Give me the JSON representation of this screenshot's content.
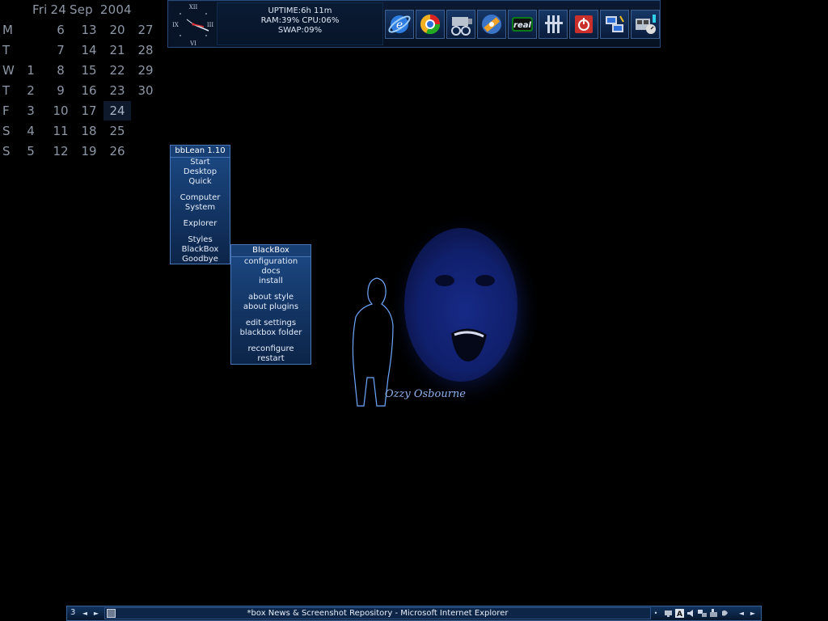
{
  "calendar": {
    "header": {
      "weekday": "Fri",
      "day": "24",
      "month": "Sep",
      "year": "2004"
    },
    "rows": [
      {
        "label": "M",
        "days": [
          "",
          "6",
          "13",
          "20",
          "27"
        ]
      },
      {
        "label": "T",
        "days": [
          "",
          "7",
          "14",
          "21",
          "28"
        ]
      },
      {
        "label": "W",
        "days": [
          "1",
          "8",
          "15",
          "22",
          "29"
        ]
      },
      {
        "label": "T",
        "days": [
          "2",
          "9",
          "16",
          "23",
          "30"
        ]
      },
      {
        "label": "F",
        "days": [
          "3",
          "10",
          "17",
          "24",
          ""
        ]
      },
      {
        "label": "S",
        "days": [
          "4",
          "11",
          "18",
          "25",
          ""
        ]
      },
      {
        "label": "S",
        "days": [
          "5",
          "12",
          "19",
          "26",
          ""
        ]
      }
    ],
    "today": "24"
  },
  "toolbar": {
    "clock": {
      "n12": "XII",
      "n3": "III",
      "n6": "VI",
      "n9": "IX"
    },
    "sysmon": {
      "line1": "UPTIME:6h 11m",
      "line2": "RAM:39% CPU:06%",
      "line3": "SWAP:09%"
    },
    "icons": [
      {
        "name": "internet-explorer-icon",
        "label": ""
      },
      {
        "name": "browser-ring-icon",
        "label": ""
      },
      {
        "name": "film-reel-icon",
        "label": ""
      },
      {
        "name": "media-player-icon",
        "label": ""
      },
      {
        "name": "realplayer-icon",
        "label": "real"
      },
      {
        "name": "tuning-bars-icon",
        "label": ""
      },
      {
        "name": "shutdown-icon",
        "label": ""
      },
      {
        "name": "network-computer-icon",
        "label": ""
      },
      {
        "name": "system-tools-icon",
        "label": ""
      }
    ]
  },
  "wallpaper": {
    "signature": "Ozzy Osbourne"
  },
  "menu_main": {
    "title": "bbLean 1.10",
    "groups": [
      [
        "Start",
        "Desktop",
        "Quick"
      ],
      [
        "Computer",
        "System"
      ],
      [
        "Explorer"
      ],
      [
        "Styles",
        "BlackBox",
        "Goodbye"
      ]
    ]
  },
  "menu_blackbox": {
    "title": "BlackBox",
    "groups": [
      [
        "configuration",
        "docs",
        "install"
      ],
      [
        "about style",
        "about plugins"
      ],
      [
        "edit settings",
        "blackbox folder"
      ],
      [
        "reconfigure",
        "restart"
      ]
    ]
  },
  "taskbar": {
    "workspace": "3",
    "task_title": "*box News & Screenshot Repository - Microsoft Internet Explorer",
    "left_prev": "◄",
    "left_next": "►",
    "right_prev": "◄",
    "right_next": "►",
    "tray_dot": "•"
  },
  "colors": {
    "background": "#000000",
    "accent": "#1c4a86",
    "border": "#4775b5",
    "calendar_text": "#8d97a6"
  }
}
